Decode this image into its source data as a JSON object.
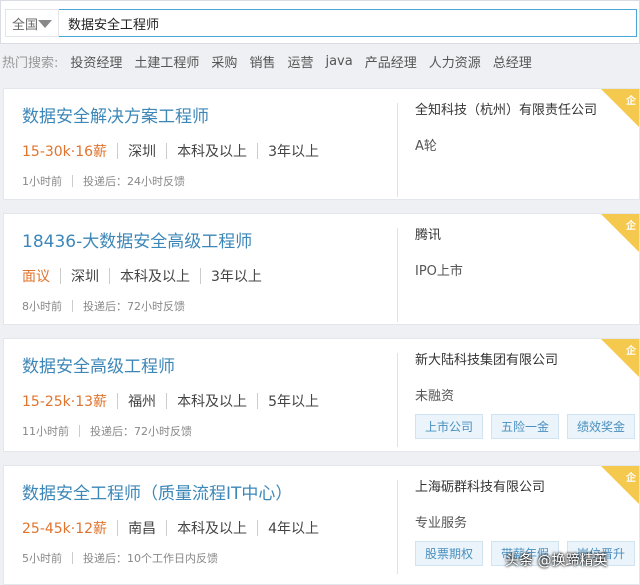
{
  "search": {
    "region": "全国",
    "query": "数据安全工程师"
  },
  "hot": {
    "title": "热门搜索:",
    "items": [
      "投资经理",
      "土建工程师",
      "采购",
      "销售",
      "运营",
      "java",
      "产品经理",
      "人力资源",
      "总经理"
    ]
  },
  "jobs": [
    {
      "title": "数据安全解决方案工程师",
      "salary": "15-30k·16薪",
      "city": "深圳",
      "edu": "本科及以上",
      "exp": "3年以上",
      "time": "1小时前",
      "feedback": "投递后：24小时反馈",
      "company": "全知科技（杭州）有限责任公司",
      "stage": "A轮",
      "tags": [],
      "badge": "企"
    },
    {
      "title": "18436-大数据安全高级工程师",
      "salary": "面议",
      "city": "深圳",
      "edu": "本科及以上",
      "exp": "3年以上",
      "time": "8小时前",
      "feedback": "投递后：72小时反馈",
      "company": "腾讯",
      "stage": "IPO上市",
      "tags": [],
      "badge": "企"
    },
    {
      "title": "数据安全高级工程师",
      "salary": "15-25k·13薪",
      "city": "福州",
      "edu": "本科及以上",
      "exp": "5年以上",
      "time": "11小时前",
      "feedback": "投递后：72小时反馈",
      "company": "新大陆科技集团有限公司",
      "stage": "未融资",
      "tags": [
        "上市公司",
        "五险一金",
        "绩效奖金"
      ],
      "badge": "企"
    },
    {
      "title": "数据安全工程师（质量流程IT中心）",
      "salary": "25-45k·12薪",
      "city": "南昌",
      "edu": "本科及以上",
      "exp": "4年以上",
      "time": "5小时前",
      "feedback": "投递后：10个工作日内反馈",
      "company": "上海砺群科技有限公司",
      "stage": "专业服务",
      "tags": [
        "股票期权",
        "带薪年假",
        "岗位晋升"
      ],
      "badge": "企"
    }
  ],
  "watermark": "头条 @换蹄精英",
  "colors": {
    "link": "#3d87b8",
    "salary": "#e0742e",
    "badge": "#f5c84e"
  }
}
